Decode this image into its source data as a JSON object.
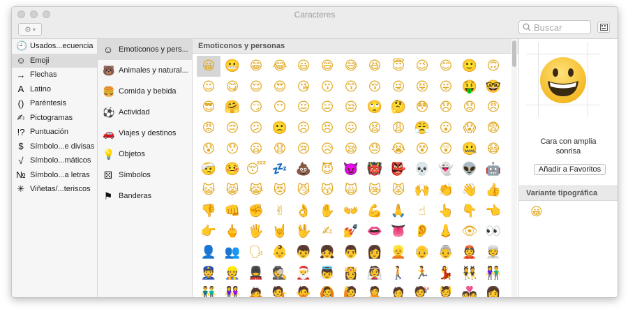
{
  "window": {
    "title": "Caracteres"
  },
  "toolbar": {
    "search_placeholder": "Buscar"
  },
  "sidebar": {
    "items": [
      {
        "glyph": "🕘",
        "label": "Usados...ecuencia",
        "icon": "clock-icon"
      },
      {
        "glyph": "☺",
        "label": "Emoji",
        "icon": "smiley-icon",
        "selected": true
      },
      {
        "glyph": "→",
        "label": "Flechas",
        "icon": "arrow-icon"
      },
      {
        "glyph": "A",
        "label": "Latino",
        "icon": "latin-letter-icon"
      },
      {
        "glyph": "()",
        "label": "Paréntesis",
        "icon": "parenthesis-icon"
      },
      {
        "glyph": "✍",
        "label": "Pictogramas",
        "icon": "pictogram-icon"
      },
      {
        "glyph": "!?",
        "label": "Puntuación",
        "icon": "punctuation-icon"
      },
      {
        "glyph": "$",
        "label": "Símbolo...e divisas",
        "icon": "currency-icon"
      },
      {
        "glyph": "√",
        "label": "Símbolo...máticos",
        "icon": "math-icon"
      },
      {
        "glyph": "№",
        "label": "Símbolo...a letras",
        "icon": "letterlike-icon"
      },
      {
        "glyph": "✳",
        "label": "Viñetas/...teriscos",
        "icon": "asterisk-icon"
      }
    ]
  },
  "categories": {
    "items": [
      {
        "glyph": "☺",
        "label": "Emoticonos y pers...",
        "icon": "smiley-icon",
        "selected": true
      },
      {
        "glyph": "🐻",
        "label": "Animales y natural...",
        "icon": "bear-icon"
      },
      {
        "glyph": "🍔",
        "label": "Comida y bebida",
        "icon": "food-icon"
      },
      {
        "glyph": "⚽",
        "label": "Actividad",
        "icon": "ball-icon"
      },
      {
        "glyph": "🚗",
        "label": "Viajes y destinos",
        "icon": "car-icon"
      },
      {
        "glyph": "💡",
        "label": "Objetos",
        "icon": "lightbulb-icon"
      },
      {
        "glyph": "⚄",
        "label": "Símbolos",
        "icon": "symbols-icon"
      },
      {
        "glyph": "⚑",
        "label": "Banderas",
        "icon": "flag-icon"
      }
    ]
  },
  "grid": {
    "title": "Emoticonos y personas",
    "emojis": [
      "😀",
      "😬",
      "😁",
      "😂",
      "😃",
      "😄",
      "😅",
      "😆",
      "😇",
      "😉",
      "😊",
      "🙂",
      "🙃",
      "☺",
      "😋",
      "😌",
      "😍",
      "😘",
      "😗",
      "😙",
      "😚",
      "😜",
      "😝",
      "😛",
      "🤑",
      "🤓",
      "😎",
      "🤗",
      "😏",
      "😶",
      "😐",
      "😑",
      "😒",
      "🙄",
      "🤔",
      "😳",
      "😞",
      "😟",
      "😠",
      "😡",
      "😔",
      "😕",
      "🙁",
      "☹",
      "😣",
      "😖",
      "😫",
      "😩",
      "😤",
      "😮",
      "😱",
      "😨",
      "😰",
      "😯",
      "😦",
      "😧",
      "😢",
      "😥",
      "😪",
      "😓",
      "😭",
      "😵",
      "😲",
      "🤐",
      "😷",
      "🤕",
      "🤒",
      "😴",
      "💤",
      "💩",
      "😈",
      "👿",
      "👹",
      "👺",
      "💀",
      "👻",
      "👽",
      "🤖",
      "😺",
      "😸",
      "😹",
      "😻",
      "😼",
      "😽",
      "🙀",
      "😿",
      "😾",
      "🙌",
      "👏",
      "👋",
      "👍",
      "👎",
      "👊",
      "✊",
      "✌",
      "👌",
      "✋",
      "👐",
      "💪",
      "🙏",
      "☝",
      "👆",
      "👇",
      "👈",
      "👉",
      "🖕",
      "🖐",
      "🤘",
      "🖖",
      "✍",
      "💅",
      "👄",
      "👅",
      "👂",
      "👃",
      "👁",
      "👀",
      "👤",
      "👥",
      "🗣",
      "👶",
      "👦",
      "👧",
      "👨",
      "👩",
      "👱",
      "👴",
      "👵",
      "👲",
      "👳",
      "👮",
      "👷",
      "💂",
      "🕵",
      "🎅",
      "👼",
      "👸",
      "👰",
      "🚶",
      "🏃",
      "💃",
      "👯",
      "👫",
      "👬",
      "👭",
      "🙇",
      "💁",
      "🙅",
      "🙆",
      "🙋",
      "🙎",
      "🙍",
      "💇",
      "💆",
      "💑",
      "👩"
    ]
  },
  "detail": {
    "preview_emoji": "😀",
    "name_line1": "Cara con amplia",
    "name_line2": "sonrisa",
    "favorites_button": "Añadir a Favoritos",
    "variant_title": "Variante tipográfica",
    "variant_emoji": "😀"
  }
}
